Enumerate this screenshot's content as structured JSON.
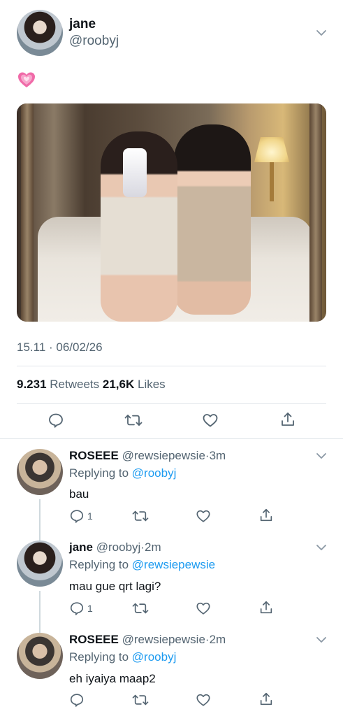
{
  "main_tweet": {
    "display_name": "jane",
    "handle": "@roobyj",
    "emoji": "heart-emoji",
    "timestamp": "15.11 · 06/02/26",
    "retweets_count": "9.231",
    "retweets_label": "Retweets",
    "likes_count": "21,6K",
    "likes_label": "Likes"
  },
  "replies": [
    {
      "display_name": "ROSEEE",
      "handle": "@rewsiepewsie",
      "time": "3m",
      "replying_label": "Replying to",
      "replying_to": "@roobyj",
      "text": "bau",
      "reply_count": "1"
    },
    {
      "display_name": "jane",
      "handle": "@roobyj",
      "time": "2m",
      "replying_label": "Replying to",
      "replying_to": "@rewsiepewsie",
      "text": "mau gue qrt lagi?",
      "reply_count": "1"
    },
    {
      "display_name": "ROSEEE",
      "handle": "@rewsiepewsie",
      "time": "2m",
      "replying_label": "Replying to",
      "replying_to": "@roobyj",
      "text": "eh iyaiya maap2",
      "reply_count": ""
    }
  ],
  "colors": {
    "text": "#0f1419",
    "secondary": "#536471",
    "link": "#1d9bf0",
    "divider": "#e1e6ea"
  },
  "icons": [
    "chevron-down-icon",
    "reply-icon",
    "retweet-icon",
    "like-icon",
    "share-icon"
  ]
}
